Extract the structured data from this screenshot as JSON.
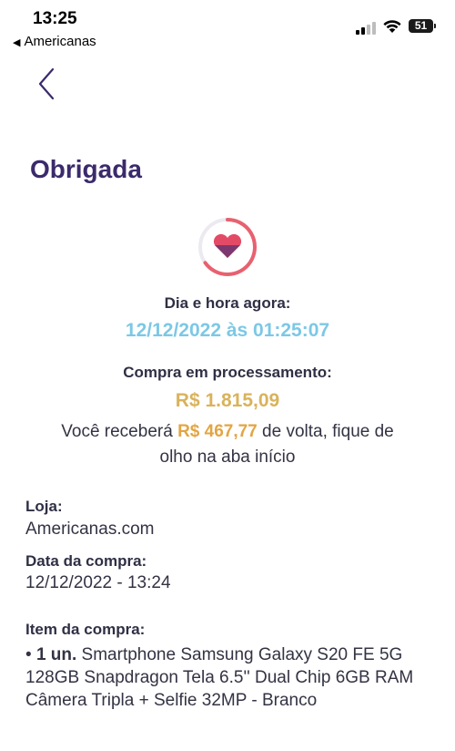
{
  "status_bar": {
    "time": "13:25",
    "back_app_label": "Americanas",
    "battery": "51"
  },
  "colors": {
    "title": "#3b2a6b",
    "datetime": "#7cc8e6",
    "total": "#d9b35b",
    "cashback": "#e3a543",
    "emblem_ring": "#e8616f",
    "emblem_heart": "#e34a66"
  },
  "header": {
    "title": "Obrigada"
  },
  "summary": {
    "datetime_label": "Dia e hora agora:",
    "datetime_value": "12/12/2022 às 01:25:07",
    "purchase_label": "Compra em processamento:",
    "total_value": "R$ 1.815,09",
    "cashback_prefix": "Você receberá ",
    "cashback_amount": "R$ 467,77",
    "cashback_suffix_line1": " de volta, fique de",
    "cashback_suffix_line2": "olho na aba início"
  },
  "details": {
    "store_label": "Loja:",
    "store_value": "Americanas.com",
    "date_label": "Data da compra:",
    "date_value": "12/12/2022 - 13:24",
    "item_label": "Item da compra:",
    "item_bullet": "• ",
    "item_qty": "1 un.",
    "item_description": " Smartphone Samsung Galaxy S20 FE 5G 128GB Snapdragon Tela 6.5'' Dual Chip 6GB RAM Câmera Tripla + Selfie 32MP - Branco"
  }
}
